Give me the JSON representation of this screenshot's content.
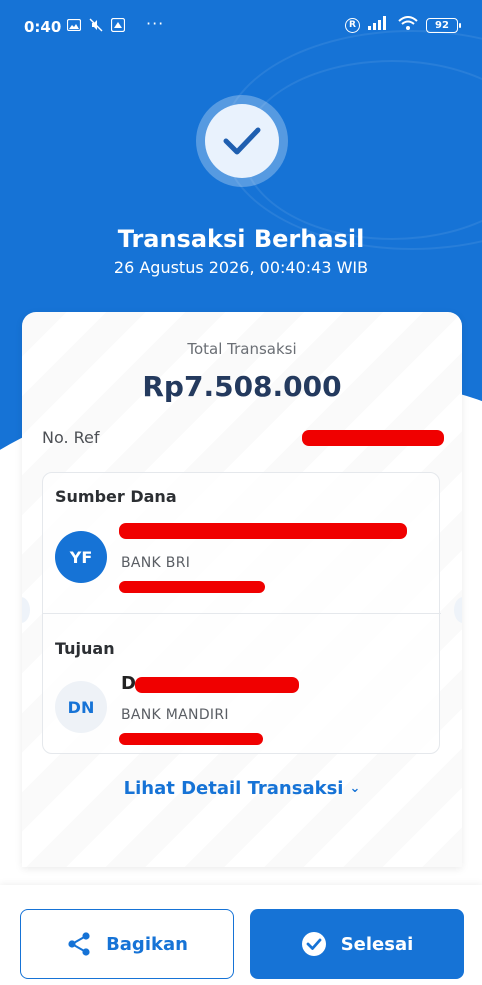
{
  "status_bar": {
    "time": "0:40",
    "dots": "···",
    "r_badge": "R",
    "battery": "92"
  },
  "header": {
    "title": "Transaksi Berhasil",
    "datetime": "26 Agustus 2026, 00:40:43 WIB"
  },
  "receipt": {
    "total_label": "Total Transaksi",
    "total_amount": "Rp7.508.000",
    "ref_label": "No. Ref",
    "source": {
      "label": "Sumber Dana",
      "initials": "YF",
      "bank": "BANK BRI"
    },
    "destination": {
      "label": "Tujuan",
      "initials": "DN",
      "name_initial": "D",
      "bank": "BANK MANDIRI"
    },
    "detail_link": "Lihat Detail Transaksi"
  },
  "actions": {
    "share_label": "Bagikan",
    "done_label": "Selesai"
  },
  "colors": {
    "primary": "#1673d6",
    "redaction": "#f00000",
    "amount": "#243a5e"
  }
}
